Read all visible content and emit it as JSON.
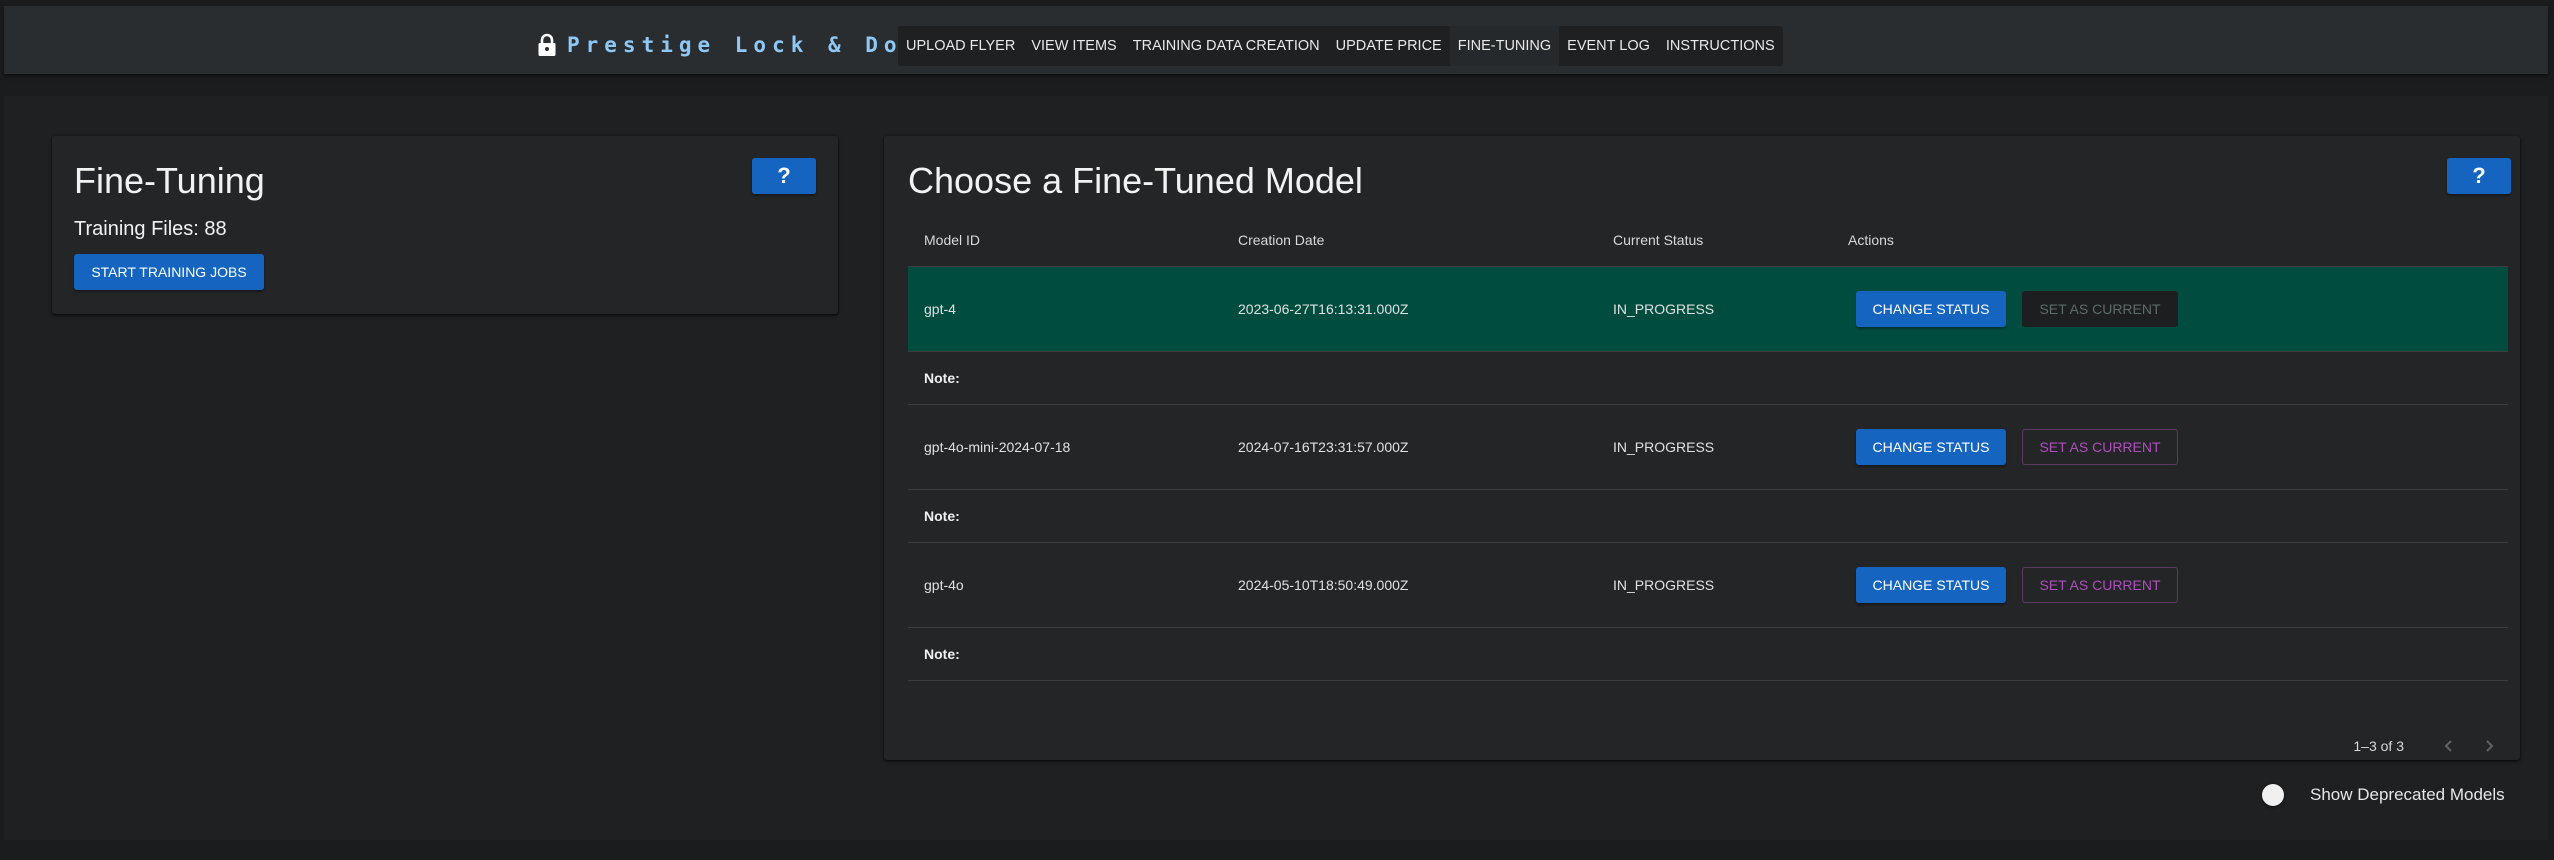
{
  "app": {
    "brand": "Prestige Lock & Door",
    "nav": [
      "UPLOAD FLYER",
      "VIEW ITEMS",
      "TRAINING DATA CREATION",
      "UPDATE PRICE",
      "FINE-TUNING",
      "EVENT LOG",
      "INSTRUCTIONS"
    ],
    "active_nav": "FINE-TUNING"
  },
  "fine_tuning": {
    "title": "Fine-Tuning",
    "help_label": "?",
    "training_files": "Training Files: 88",
    "start_button": "START TRAINING JOBS"
  },
  "models": {
    "title": "Choose a Fine-Tuned Model",
    "help_label": "?",
    "columns": [
      "Model ID",
      "Creation Date",
      "Current Status",
      "Actions"
    ],
    "rows": [
      {
        "model_id": "gpt-4",
        "creation_date": "2023-06-27T16:13:31.000Z",
        "status": "IN_PROGRESS",
        "change_label": "CHANGE STATUS",
        "set_label": "SET AS CURRENT",
        "note": "Note:",
        "selected": true
      },
      {
        "model_id": "gpt-4o-mini-2024-07-18",
        "creation_date": "2024-07-16T23:31:57.000Z",
        "status": "IN_PROGRESS",
        "change_label": "CHANGE STATUS",
        "set_label": "SET AS CURRENT",
        "note": "Note:",
        "selected": false
      },
      {
        "model_id": "gpt-4o",
        "creation_date": "2024-05-10T18:50:49.000Z",
        "status": "IN_PROGRESS",
        "change_label": "CHANGE STATUS",
        "set_label": "SET AS CURRENT",
        "note": "Note:",
        "selected": false
      }
    ],
    "pagination": "1–3 of 3"
  },
  "deprecated_toggle": {
    "label": "Show Deprecated Models",
    "checked": false
  },
  "colors": {
    "primary": "#1565c0",
    "selected_row": "#004d40",
    "brand_text": "#8ec8f6",
    "secondary_text": "#b04ec0"
  },
  "icons": {
    "brand": "lock-icon",
    "prev": "chevron-left-icon",
    "next": "chevron-right-icon"
  }
}
